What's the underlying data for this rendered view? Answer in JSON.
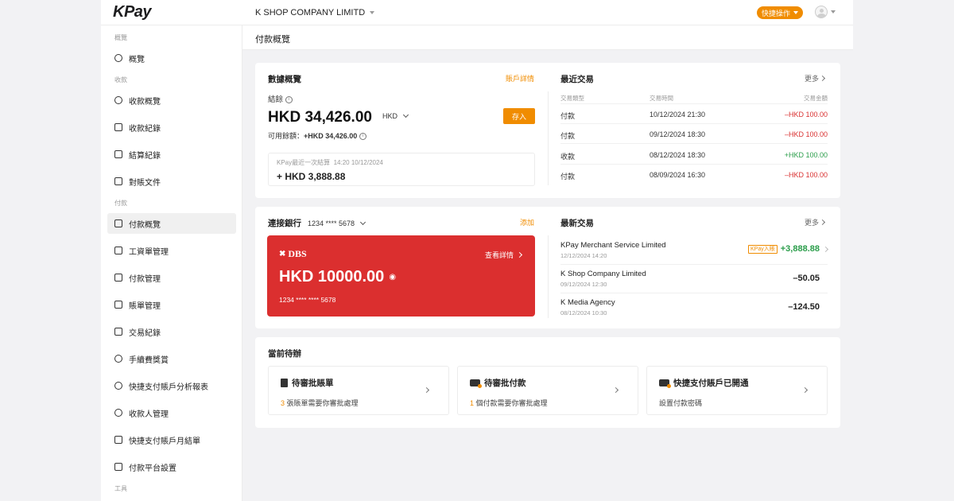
{
  "header": {
    "logo": "KPay",
    "company": "K SHOP COMPANY LIMITD",
    "quick_action": "快捷操作"
  },
  "sidebar": {
    "sections": {
      "overview": "概覽",
      "collect": "收款",
      "pay": "付款",
      "tools": "工具"
    },
    "items": {
      "overview": "概覽",
      "collect_overview": "收款概覽",
      "collect_records": "收款紀錄",
      "settlement_records": "結算紀錄",
      "reconcile_docs": "對賬文件",
      "pay_overview": "付款概覽",
      "payroll": "工資單管理",
      "pay_manage": "付款管理",
      "bill_manage": "賬單管理",
      "tx_records": "交易紀錄",
      "fee_rewards": "手續費獎賞",
      "fps_report": "快捷支付賬戶分析報表",
      "payee_manage": "收款人管理",
      "fps_monthly": "快捷支付賬戶月結單",
      "platform_settings": "付款平台設置"
    }
  },
  "page": {
    "title": "付款概覽"
  },
  "data_overview": {
    "title": "數據概覽",
    "account_link": "賬戶詳情",
    "balance_label": "結餘",
    "balance": "HKD 34,426.00",
    "currency": "HKD",
    "deposit": "存入",
    "available_label": "可用餘額：",
    "available": "+HKD 34,426.00",
    "last_settle_label": "KPay最近一次結算",
    "last_settle_time": "14:20 10/12/2024",
    "last_settle_amount": "+ HKD 3,888.88"
  },
  "recent_tx": {
    "title": "最近交易",
    "more": "更多",
    "headers": {
      "type": "交易類型",
      "time": "交易時間",
      "amount": "交易金額"
    },
    "rows": [
      {
        "type": "付款",
        "time": "10/12/2024 21:30",
        "amount": "–HKD 100.00"
      },
      {
        "type": "付款",
        "time": "09/12/2024 18:30",
        "amount": "–HKD 100.00"
      },
      {
        "type": "收款",
        "time": "08/12/2024 18:30",
        "amount": "+HKD 100.00"
      },
      {
        "type": "付款",
        "time": "08/09/2024 16:30",
        "amount": "–HKD 100.00"
      }
    ]
  },
  "bank": {
    "title": "連接銀行",
    "account": "1234 **** 5678",
    "add": "添加",
    "bank_name": "DBS",
    "view_detail": "查看詳情",
    "balance": "HKD 10000.00",
    "card_number": "1234 **** **** 5678"
  },
  "latest_tx": {
    "title": "最新交易",
    "more": "更多",
    "rows": [
      {
        "name": "KPay Merchant Service Limited",
        "time": "12/12/2024 14:20",
        "badge": "KPay入賬",
        "amount": "+3,888.88"
      },
      {
        "name": "K Shop Company Limited",
        "time": "09/12/2024 12:30",
        "amount": "–50.05"
      },
      {
        "name": "K Media Agency",
        "time": "08/12/2024 10:30",
        "amount": "–124.50"
      }
    ]
  },
  "pending": {
    "title": "當前待辦",
    "items": [
      {
        "title": "待審批賬單",
        "count": "3",
        "sub": " 張賬單需要你審批處理"
      },
      {
        "title": "待審批付款",
        "count": "1",
        "sub": " 個付款需要你審批處理"
      },
      {
        "title": "快捷支付賬戶已開通",
        "count": "",
        "sub": "設置付款密碼"
      }
    ]
  },
  "colors": {
    "accent": "#f08c00",
    "bank_card": "#db2f2f",
    "negative": "#d93030",
    "positive": "#2a9d4a"
  }
}
